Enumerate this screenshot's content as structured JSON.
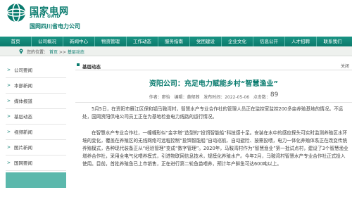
{
  "brand": {
    "name_cn": "国家电网",
    "name_en": "STATE GRID",
    "company": "国网四川省电力公司",
    "color": "#0a7c6f"
  },
  "nav": {
    "items": [
      "首页",
      "公司概况",
      "新闻中心",
      "物资管理",
      "工作动态",
      "服务指南",
      "党团建设",
      "企业文化",
      "信息公开",
      "人才招聘",
      "联系我们"
    ]
  },
  "breadcrumb": {
    "prefix": "您的位置：",
    "home": "首页",
    "separator": ">>",
    "current": "基层动态"
  },
  "sidebar": {
    "items": [
      "公司要闻",
      "本部新闻",
      "媒体报道",
      "基层动态",
      "视频新闻",
      "图片新闻",
      "国网要闻"
    ]
  },
  "content": {
    "section_label": "基层动态",
    "back_label": "关闭",
    "title": "资阳公司：充足电力赋能乡村“智慧渔业”",
    "meta": {
      "author_label": "作者：",
      "author": "廖怡",
      "editor_label": "编辑：",
      "editor": "黄郁茜",
      "date_label": "发布时间：",
      "date": "2022-05-06",
      "views_label": "点击数：",
      "views": "89"
    },
    "paragraphs": [
      "5月5日，在资阳市雁江区保和镇马鞍湾村，智慧水产专业合作社的管理人员正在监控室监控200多亩养殖基地的情况。不远处，国网资阳供电公司员工正在为基地检查电力线路的运行情况。",
      "在智慧水产专业合作社，一幢幢形似“金字塔”造型的“投饵智能船”科技感十足。安装在水中的感应探头可实时监测养殖区水环境的变化，覆盖在养殖区的无线网络可远程控制“投饵智能船”自动巡航、自动避险、按需投喂，电力一体化养殖体系正在改变传统养殖模式，各种现代装备正从“经验管理”变成“数字管理”。2020年，马鞍湾村作为“智慧渔业”第一批试点村，建设了3个智慧渔业增养合作社，采用全电气化喂养模式，引进物联网信息技术，规模化养殖水产。今年2月，马鞍湾村智慧水产专业合作社正式投入使用。目前，首批养殖鱼已上市销售，正在进行第二轮鱼苗喂养，预计年产鲜鱼可达600吨以上。"
    ]
  }
}
